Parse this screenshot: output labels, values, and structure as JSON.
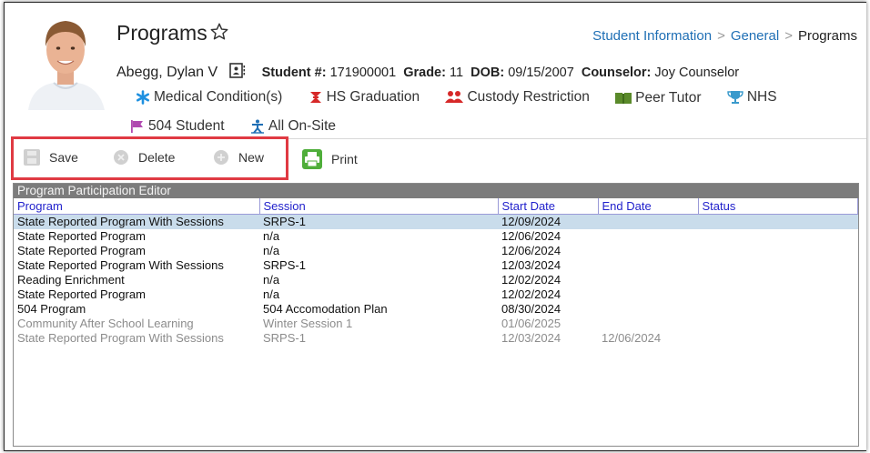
{
  "header": {
    "title": "Programs",
    "breadcrumb": [
      "Student Information",
      "General",
      "Programs"
    ]
  },
  "student": {
    "name": "Abegg, Dylan V",
    "number_label": "Student #:",
    "number": "171900001",
    "grade_label": "Grade:",
    "grade": "11",
    "dob_label": "DOB:",
    "dob": "09/15/2007",
    "counselor_label": "Counselor:",
    "counselor": "Joy Counselor"
  },
  "flags": [
    {
      "label": "Medical Condition(s)",
      "icon": "asterisk-icon",
      "color": "#1e90e0"
    },
    {
      "label": "HS Graduation",
      "icon": "graduation-icon",
      "color": "#d62828"
    },
    {
      "label": "Custody Restriction",
      "icon": "people-icon",
      "color": "#d62828"
    },
    {
      "label": "Peer Tutor",
      "icon": "book-icon",
      "color": "#5a8a2a"
    },
    {
      "label": "NHS",
      "icon": "trophy-icon",
      "color": "#3a9acc"
    }
  ],
  "flags_row2": [
    {
      "label": "504 Student",
      "icon": "flag-icon",
      "color": "#b04ab0"
    },
    {
      "label": "All On-Site",
      "icon": "accessibility-icon",
      "color": "#1f6fb5"
    }
  ],
  "toolbar": {
    "save_label": "Save",
    "delete_label": "Delete",
    "new_label": "New",
    "print_label": "Print"
  },
  "editor": {
    "title": "Program Participation Editor",
    "columns": [
      "Program",
      "Session",
      "Start Date",
      "End Date",
      "Status"
    ],
    "rows": [
      {
        "program": "State Reported Program With Sessions",
        "session": "SRPS-1",
        "start": "12/09/2024",
        "end": "",
        "status": "",
        "selected": true,
        "inactive": false
      },
      {
        "program": "State Reported Program",
        "session": "n/a",
        "start": "12/06/2024",
        "end": "",
        "status": "",
        "selected": false,
        "inactive": false
      },
      {
        "program": "State Reported Program",
        "session": "n/a",
        "start": "12/06/2024",
        "end": "",
        "status": "",
        "selected": false,
        "inactive": false
      },
      {
        "program": "State Reported Program With Sessions",
        "session": "SRPS-1",
        "start": "12/03/2024",
        "end": "",
        "status": "",
        "selected": false,
        "inactive": false
      },
      {
        "program": "Reading Enrichment",
        "session": "n/a",
        "start": "12/02/2024",
        "end": "",
        "status": "",
        "selected": false,
        "inactive": false
      },
      {
        "program": "State Reported Program",
        "session": "n/a",
        "start": "12/02/2024",
        "end": "",
        "status": "",
        "selected": false,
        "inactive": false
      },
      {
        "program": "504 Program",
        "session": "504 Accomodation Plan",
        "start": "08/30/2024",
        "end": "",
        "status": "",
        "selected": false,
        "inactive": false
      },
      {
        "program": "Community After School Learning",
        "session": "Winter Session 1",
        "start": "01/06/2025",
        "end": "",
        "status": "",
        "selected": false,
        "inactive": true
      },
      {
        "program": "State Reported Program With Sessions",
        "session": "SRPS-1",
        "start": "12/03/2024",
        "end": "12/06/2024",
        "status": "",
        "selected": false,
        "inactive": true
      }
    ]
  },
  "colors": {
    "link": "#1f6fb5",
    "highlight_border": "#e03a43",
    "selected_row": "#c9dceb",
    "editor_header": "#7c7c7c",
    "column_header_text": "#2222cc"
  }
}
